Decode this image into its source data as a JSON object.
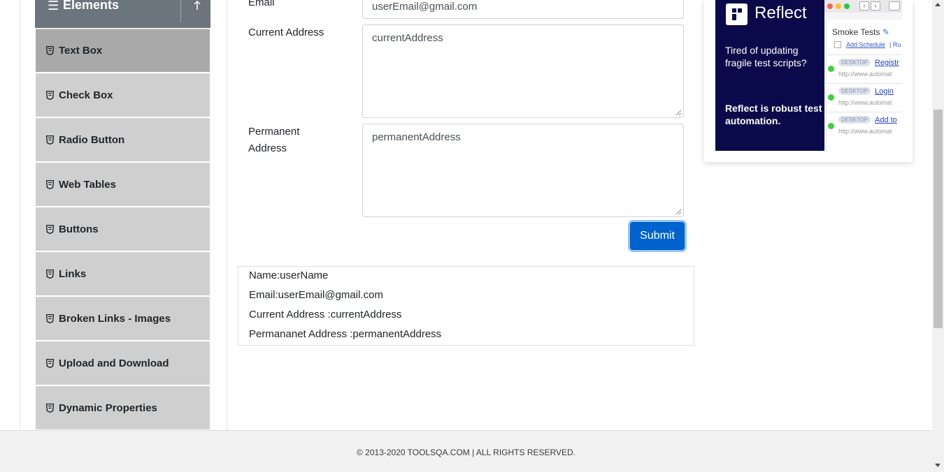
{
  "sidebar": {
    "group_title": "Elements",
    "items": [
      {
        "label": "Text Box",
        "active": true
      },
      {
        "label": "Check Box"
      },
      {
        "label": "Radio Button"
      },
      {
        "label": "Web Tables"
      },
      {
        "label": "Buttons"
      },
      {
        "label": "Links"
      },
      {
        "label": "Broken Links - Images"
      },
      {
        "label": "Upload and Download"
      },
      {
        "label": "Dynamic Properties"
      }
    ]
  },
  "form": {
    "email_label": "Email",
    "email_value": "userEmail@gmail.com",
    "current_address_label": "Current Address",
    "current_address_value": "currentAddress",
    "permanent_address_label_line1": "Permanent",
    "permanent_address_label_line2": "Address",
    "permanent_address_value": "permanentAddress",
    "submit_label": "Submit"
  },
  "output": {
    "name": "Name:userName",
    "email": "Email:userEmail@gmail.com",
    "current_address": "Current Address :currentAddress",
    "permanent_address": "Permananet Address :permanentAddress"
  },
  "ad": {
    "brand": "Reflect",
    "tagline": "Tired of updating fragile test scripts?",
    "strong": "Reflect is robust test automation.",
    "panel_title": "Smoke Tests",
    "schedule_link": "Add Schedule",
    "schedule_sep": "| Ru",
    "rows": [
      {
        "badge": "DESKTOP",
        "link": "Registr",
        "url": "http://www.automat"
      },
      {
        "badge": "DESKTOP",
        "link": "Login",
        "url": "http://www.automat"
      },
      {
        "badge": "DESKTOP",
        "link": "Add to",
        "url": "http://www.automat"
      }
    ]
  },
  "footer": {
    "copyright": "© 2013-2020 TOOLSQA.COM | ALL RIGHTS RESERVED."
  },
  "colors": {
    "sidebar_header": "#6c757d",
    "menu_item": "#cfcfcf",
    "menu_item_active": "#a9a9a9",
    "submit": "#0062cc",
    "ad_dark": "#0a0a4a"
  }
}
